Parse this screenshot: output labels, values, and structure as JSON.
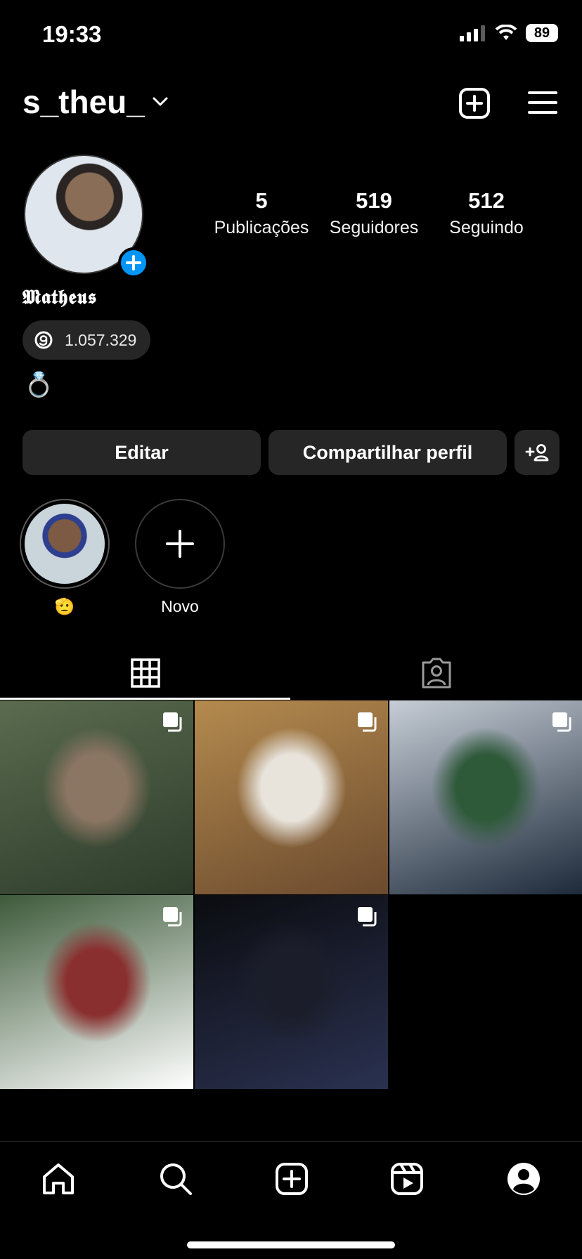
{
  "status": {
    "time": "19:33",
    "battery": "89"
  },
  "header": {
    "username": "s_theu_"
  },
  "stats": [
    {
      "value": "5",
      "label": "Publicações"
    },
    {
      "value": "519",
      "label": "Seguidores"
    },
    {
      "value": "512",
      "label": "Seguindo"
    }
  ],
  "profile": {
    "name": "𝕸𝖆𝖙𝖍𝖊𝖚𝖘",
    "threads_count": "1.057.329",
    "bio_emoji": "💍"
  },
  "buttons": {
    "edit": "Editar",
    "share": "Compartilhar perfil"
  },
  "highlights": [
    {
      "label": "🫡"
    },
    {
      "label": "Novo"
    }
  ],
  "posts": [
    {
      "colors": [
        "#5a6b4f",
        "#8b7563",
        "#2d3b2a"
      ],
      "multi": true
    },
    {
      "colors": [
        "#b48a4e",
        "#e8e4dc",
        "#6b4a2e"
      ],
      "multi": true
    },
    {
      "colors": [
        "#c6cdd6",
        "#2f5a3a",
        "#1d2a3a"
      ],
      "multi": true
    },
    {
      "colors": [
        "#3d5a3a",
        "#8a2f2f",
        "#ffffff"
      ],
      "multi": true
    },
    {
      "colors": [
        "#0b0c10",
        "#1b1e2a",
        "#2a3150"
      ],
      "multi": true
    }
  ],
  "colors": {
    "accent": "#0095f6",
    "surface": "#262626"
  }
}
